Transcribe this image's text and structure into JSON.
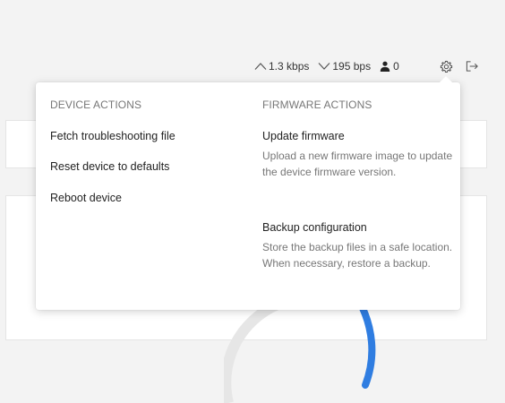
{
  "status": {
    "upload_rate": "1.3 kbps",
    "download_rate": "195 bps",
    "user_count": "0"
  },
  "icons": {
    "upload": "caret-up-icon",
    "download": "caret-down-icon",
    "users": "user-icon",
    "settings": "gear-icon",
    "logout": "logout-icon"
  },
  "colors": {
    "accent": "#2f7de1",
    "heading": "#777777",
    "text": "#222222"
  },
  "menu": {
    "device_actions": {
      "heading": "DEVICE ACTIONS",
      "items": [
        {
          "label": "Fetch troubleshooting file"
        },
        {
          "label": "Reset device to defaults"
        },
        {
          "label": "Reboot device"
        }
      ]
    },
    "firmware_actions": {
      "heading": "FIRMWARE ACTIONS",
      "items": [
        {
          "title": "Update firmware",
          "description": "Upload a new firmware image to update the device firmware version."
        },
        {
          "title": "Backup configuration",
          "description": "Store the backup files in a safe location. When necessary, restore a backup."
        }
      ]
    }
  }
}
